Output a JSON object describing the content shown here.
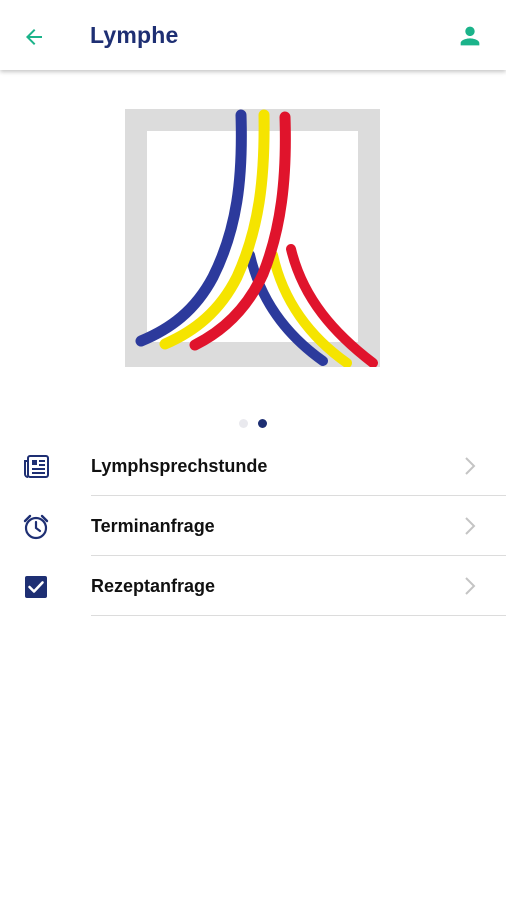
{
  "app_bar": {
    "back_icon": "arrow-left-icon",
    "title": "Lymphe",
    "user_icon": "user-icon",
    "accent_color": "#1bb38a",
    "title_color": "#1e2f73"
  },
  "slider": {
    "logo": "lymph-vessel-logo",
    "logo_colors": [
      "#2c3a9c",
      "#f5e400",
      "#e0142c"
    ],
    "page_count": 2,
    "active_page": 2
  },
  "menu": {
    "items": [
      {
        "label": "Lymphsprechstunde",
        "icon": "newspaper-icon"
      },
      {
        "label": "Terminanfrage",
        "icon": "alarm-clock-icon"
      },
      {
        "label": "Rezeptanfrage",
        "icon": "checkbox-checked-icon"
      }
    ],
    "chevron_icon": "chevron-right-icon"
  }
}
